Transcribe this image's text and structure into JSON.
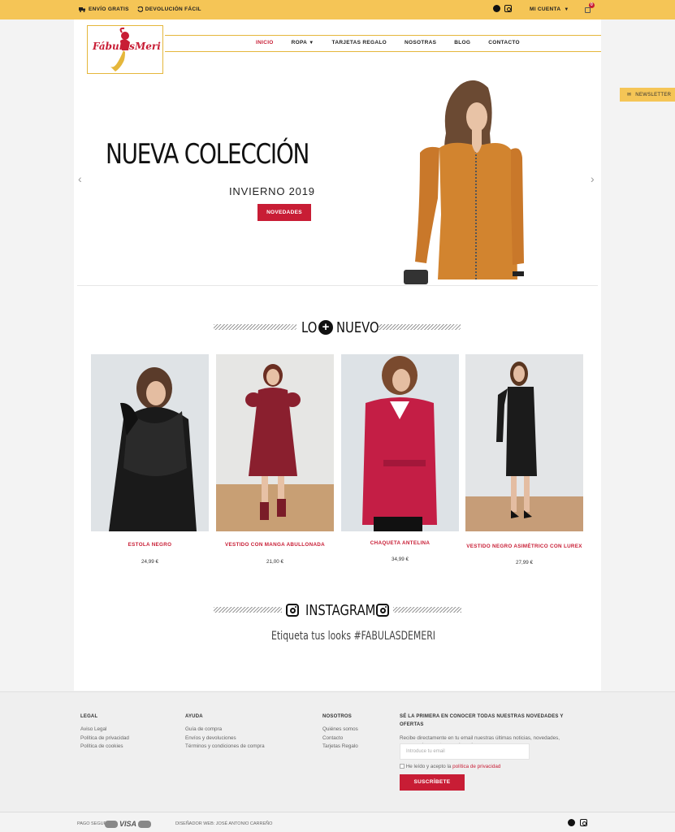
{
  "topbar": {
    "shipping": "ENVÍO GRATIS",
    "returns": "DEVOLUCIÓN FÁCIL",
    "account": "MI CUENTA",
    "cart_count": "0"
  },
  "logo": {
    "text1": "Fábulas",
    "text2": "Meri"
  },
  "nav": [
    {
      "label": "INICIO",
      "active": true
    },
    {
      "label": "ROPA",
      "dropdown": true
    },
    {
      "label": "TARJETAS REGALO"
    },
    {
      "label": "NOSOTRAS"
    },
    {
      "label": "BLOG"
    },
    {
      "label": "CONTACTO"
    }
  ],
  "newsletter_tab": "NEWSLETTER",
  "hero": {
    "title": "NUEVA COLECCIÓN",
    "subtitle": "INVIERNO 2019",
    "button": "NOVEDADES"
  },
  "new_section": {
    "title_left": "LO",
    "title_right": "NUEVO"
  },
  "products": [
    {
      "name": "ESTOLA NEGRO",
      "price": "24,99 €"
    },
    {
      "name": "VESTIDO CON MANGA ABULLONADA",
      "price": "21,00 €"
    },
    {
      "name": "CHAQUETA ANTELINA",
      "price": "34,99 €"
    },
    {
      "name": "VESTIDO NEGRO ASIMÉTRICO CON LUREX",
      "price": "27,99 €"
    }
  ],
  "instagram": {
    "title": "INSTAGRAM",
    "tagline": "Etiqueta tus looks #FABULASDEMERI"
  },
  "footer": {
    "legal": {
      "title": "LEGAL",
      "links": [
        "Aviso Legal",
        "Política de privacidad",
        "Política de cookies"
      ]
    },
    "ayuda": {
      "title": "AYUDA",
      "links": [
        "Guía de compra",
        "Envíos y devoluciones",
        "Términos y condiciones de compra"
      ]
    },
    "nosotros": {
      "title": "NOSOTROS",
      "links": [
        "Quiénes somos",
        "Contacto",
        "Tarjetas Regalo"
      ]
    },
    "newsletter": {
      "title": "SÉ LA PRIMERA EN CONOCER TODAS NUESTRAS NOVEDADES Y OFERTAS",
      "text": "Recibe directamente en tu email nuestras últimas noticias, novedades, cupones descuento y mucho más.",
      "placeholder": "Introduce tu email",
      "consent": "He leído y acepto la",
      "consent_link": "política de privacidad",
      "button": "SUSCRÍBETE"
    }
  },
  "bottom": {
    "pago": "PAGO SEGURO",
    "visa": "VISA",
    "designer": "DISEÑADOR WEB: JOSÉ ANTONIO CARREÑO"
  },
  "colors": {
    "accent": "#f5c556",
    "brand_red": "#c81d35"
  }
}
